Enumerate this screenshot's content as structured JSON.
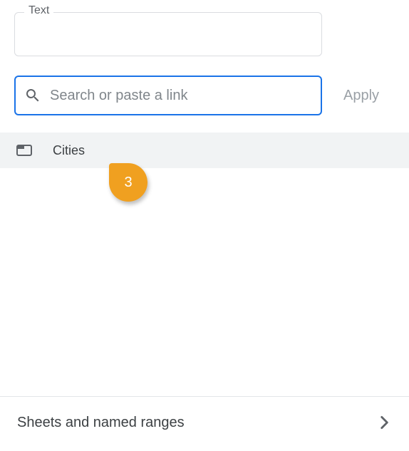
{
  "text_field": {
    "label": "Text",
    "value": ""
  },
  "search": {
    "placeholder": "Search or paste a link",
    "value": ""
  },
  "apply": {
    "label": "Apply"
  },
  "suggestion": {
    "label": "Cities"
  },
  "step_marker": {
    "number": "3"
  },
  "footer": {
    "label": "Sheets and named ranges"
  }
}
